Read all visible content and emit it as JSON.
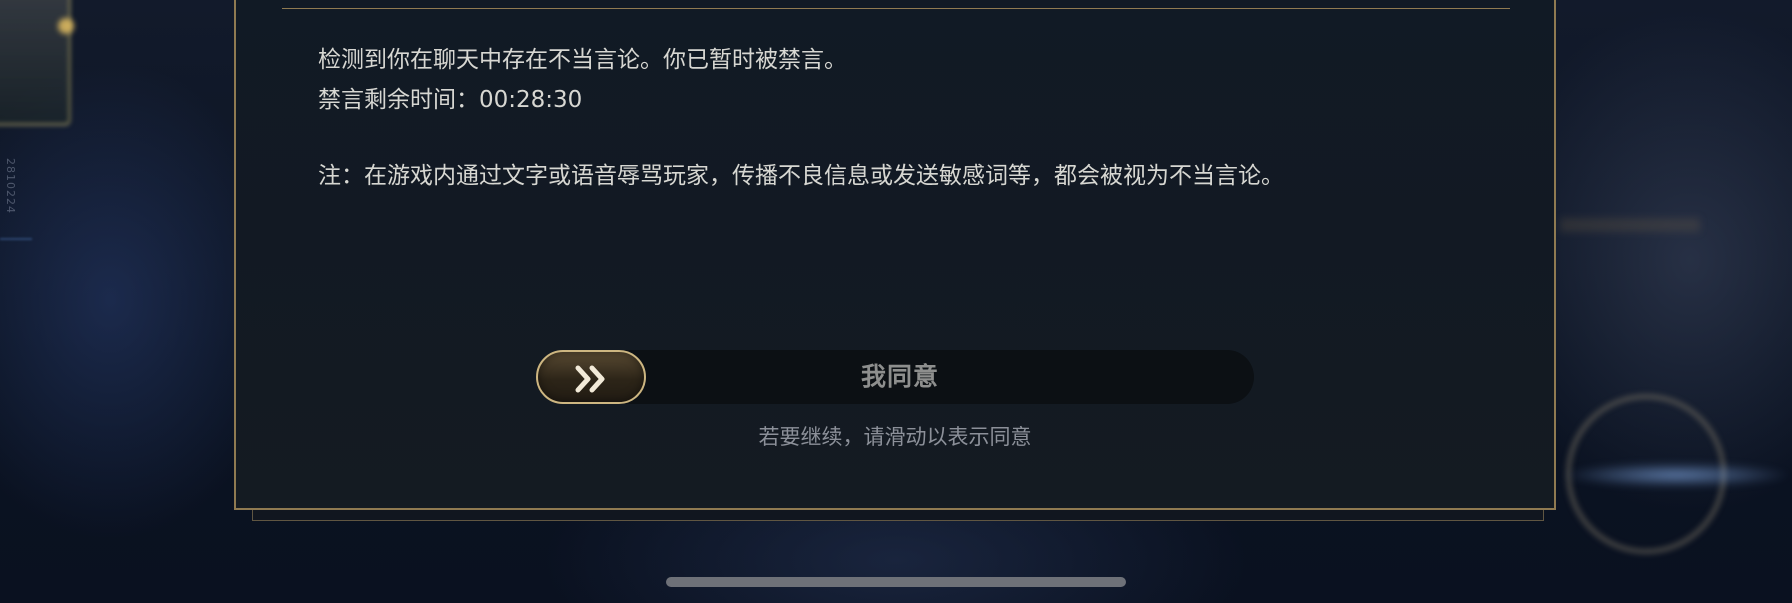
{
  "background": {
    "vertical_text": "2810224"
  },
  "dialog": {
    "message_lines": [
      "检测到你在聊天中存在不当言论。你已暂时被禁言。",
      "禁言剩余时间：00:28:30"
    ],
    "note": "注：在游戏内通过文字或语音辱骂玩家，传播不良信息或发送敏感词等，都会被视为不当言论。",
    "slider": {
      "label": "我同意",
      "handle_icon": "double-chevron-right-icon",
      "progress": 0
    },
    "hint": "若要继续，请滑动以表示同意"
  },
  "colors": {
    "accent_gold": "#cdb681",
    "border_gold": "#8f7a51",
    "text": "#d7d7d2",
    "hint_text": "#8c9099"
  }
}
